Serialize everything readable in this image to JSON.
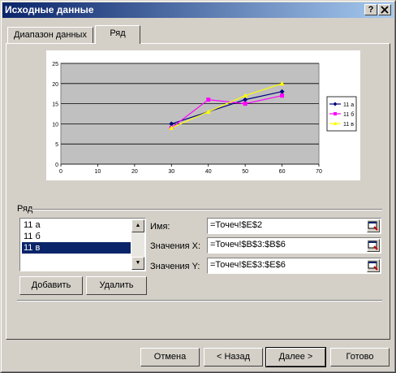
{
  "window": {
    "title": "Исходные данные",
    "help_btn": "?",
    "close_btn": "X"
  },
  "tabs": [
    {
      "label": "Диапазон данных"
    },
    {
      "label": "Ряд"
    }
  ],
  "chart_data": {
    "type": "line",
    "x": [
      30,
      40,
      50,
      60
    ],
    "series": [
      {
        "name": "11 а",
        "x": [
          30,
          50,
          60
        ],
        "y": [
          10,
          16,
          18
        ],
        "color": "#000080",
        "marker": "diamond"
      },
      {
        "name": "11 б",
        "x": [
          30,
          40,
          50,
          60
        ],
        "y": [
          9,
          16,
          15,
          17
        ],
        "color": "#ff00ff",
        "marker": "square"
      },
      {
        "name": "11 в",
        "x": [
          30,
          40,
          50,
          60
        ],
        "y": [
          9,
          13,
          17,
          20
        ],
        "color": "#ffff00",
        "marker": "triangle"
      }
    ],
    "xlim": [
      0,
      70
    ],
    "ylim": [
      0,
      25
    ],
    "xticks": [
      "0",
      "10",
      "20",
      "30",
      "40",
      "50",
      "60",
      "70"
    ],
    "yticks": [
      "0",
      "5",
      "10",
      "15",
      "20",
      "25"
    ],
    "plot_bg": "#c0c0c0",
    "grid": true,
    "legend_position": "right"
  },
  "series_section": {
    "label": "Ряд",
    "items": [
      {
        "label": "11 а"
      },
      {
        "label": "11 б"
      },
      {
        "label": "11 в"
      }
    ],
    "selected": "11 в",
    "add_button": "Добавить",
    "remove_button": "Удалить"
  },
  "fields": {
    "name_label": "Имя:",
    "name_value": "=Точеч!$E$2",
    "x_label": "Значения X:",
    "x_value": "=Точеч!$B$3:$B$6",
    "y_label": "Значения Y:",
    "y_value": "=Точеч!$E$3:$E$6"
  },
  "footer": {
    "cancel": "Отмена",
    "back": "< Назад",
    "next": "Далее >",
    "finish": "Готово"
  }
}
